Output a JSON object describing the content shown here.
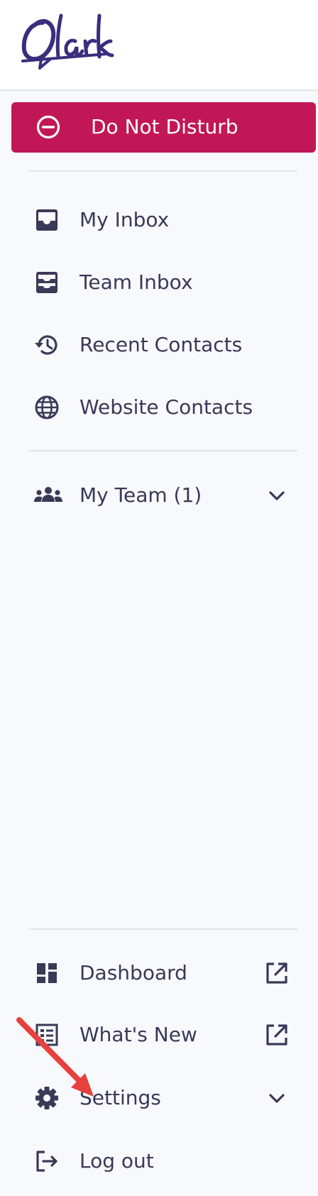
{
  "brand": {
    "logo_text": "Olark"
  },
  "status_button": {
    "label": "Do Not Disturb",
    "color": "#c21756"
  },
  "nav": {
    "my_inbox": "My Inbox",
    "team_inbox": "Team Inbox",
    "recent_contacts": "Recent Contacts",
    "website_contacts": "Website Contacts",
    "my_team": "My Team (1)",
    "dashboard": "Dashboard",
    "whats_new": "What's New",
    "settings": "Settings",
    "log_out": "Log out"
  },
  "icons": {
    "status": "minus-circle-icon",
    "my_inbox": "inbox-icon",
    "team_inbox": "team-inbox-icon",
    "recent_contacts": "history-icon",
    "website_contacts": "globe-icon",
    "my_team": "people-icon",
    "dashboard": "dashboard-icon",
    "whats_new": "newspaper-icon",
    "settings": "gear-icon",
    "log_out": "logout-icon",
    "external": "external-link-icon",
    "expand": "chevron-down-icon"
  },
  "colors": {
    "text": "#383a57",
    "sidebar_bg": "#f7f9fc",
    "accent": "#c21756",
    "annotation_arrow": "#e8403c"
  }
}
